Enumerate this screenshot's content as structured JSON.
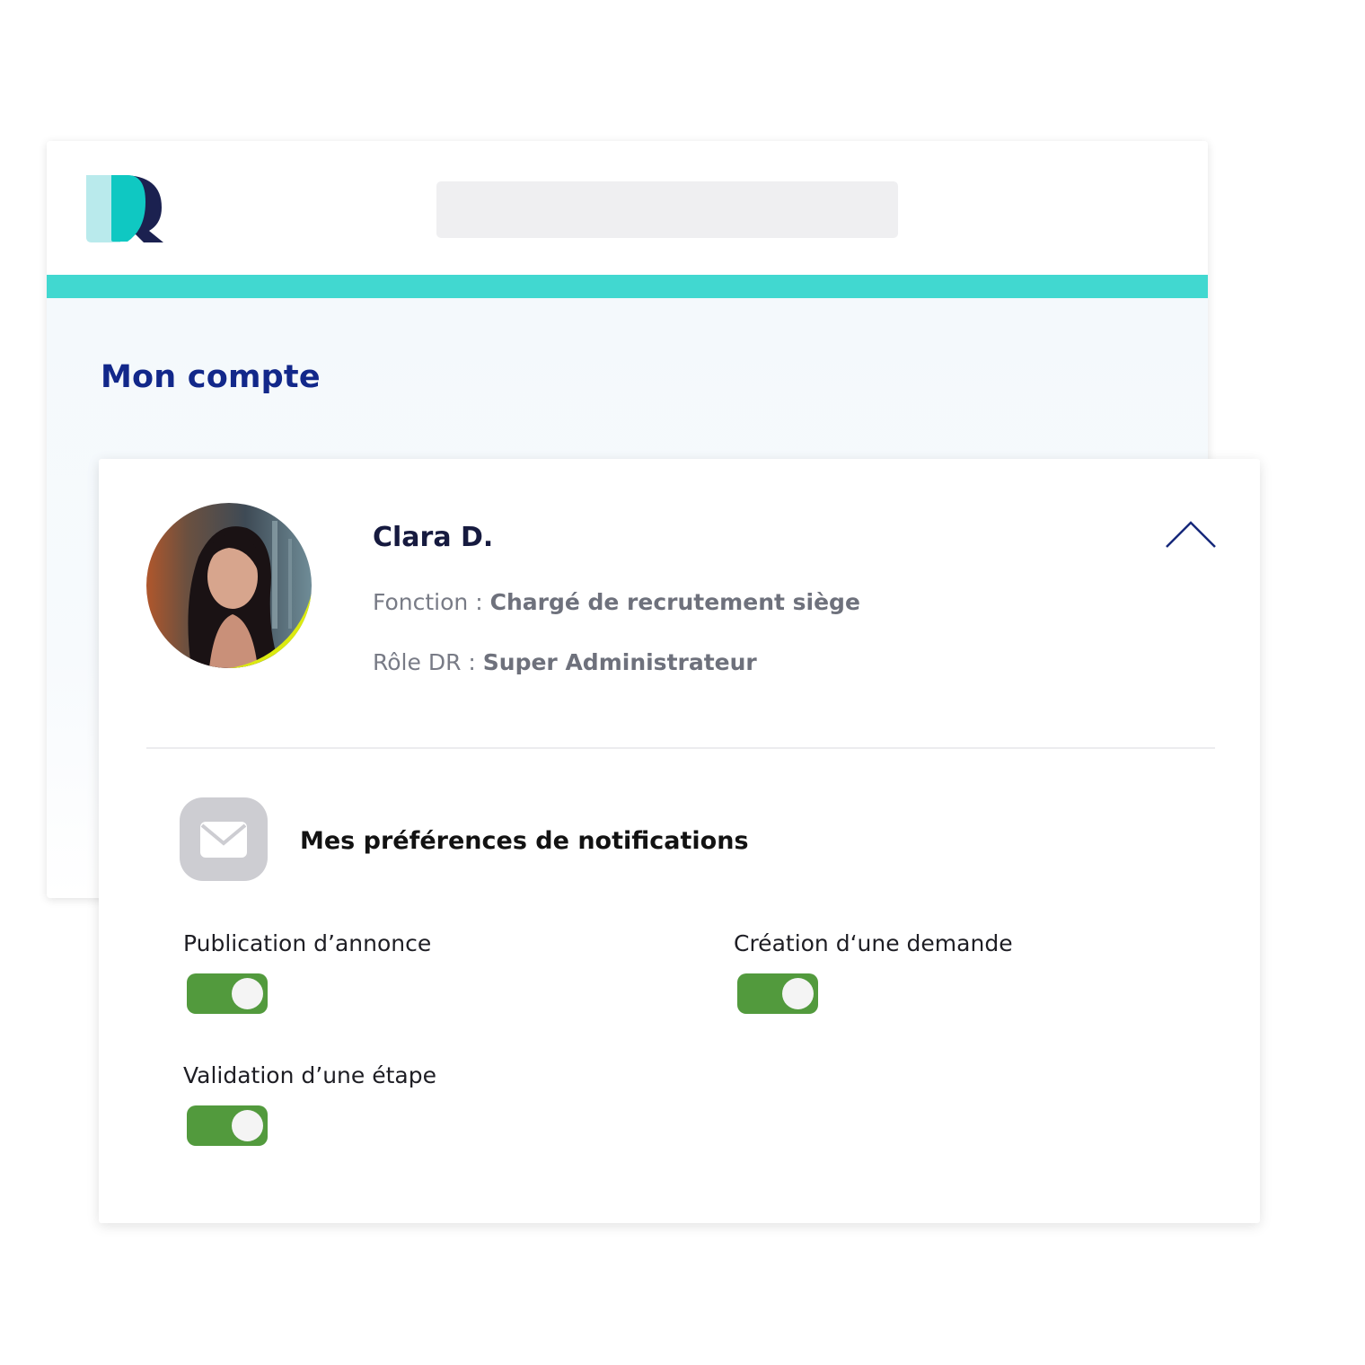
{
  "header": {
    "logo_icon": "dr-logo-icon",
    "search_value": ""
  },
  "page": {
    "title": "Mon compte"
  },
  "profile": {
    "name": "Clara D.",
    "fonction_label": "Fonction : ",
    "fonction_value": "Chargé de recrutement siège",
    "role_label": "Rôle DR : ",
    "role_value": "Super Administrateur",
    "collapse_icon": "chevron-up-icon"
  },
  "notifications": {
    "icon": "mail-icon",
    "title": "Mes préférences de notifications",
    "items": [
      {
        "label": "Publication d’annonce",
        "enabled": true
      },
      {
        "label": "Création d‘une demande",
        "enabled": true
      },
      {
        "label": "Validation d’une étape",
        "enabled": true
      }
    ]
  },
  "colors": {
    "accent": "#41d8d0",
    "title_blue": "#12288a",
    "toggle_on": "#529a3d"
  }
}
